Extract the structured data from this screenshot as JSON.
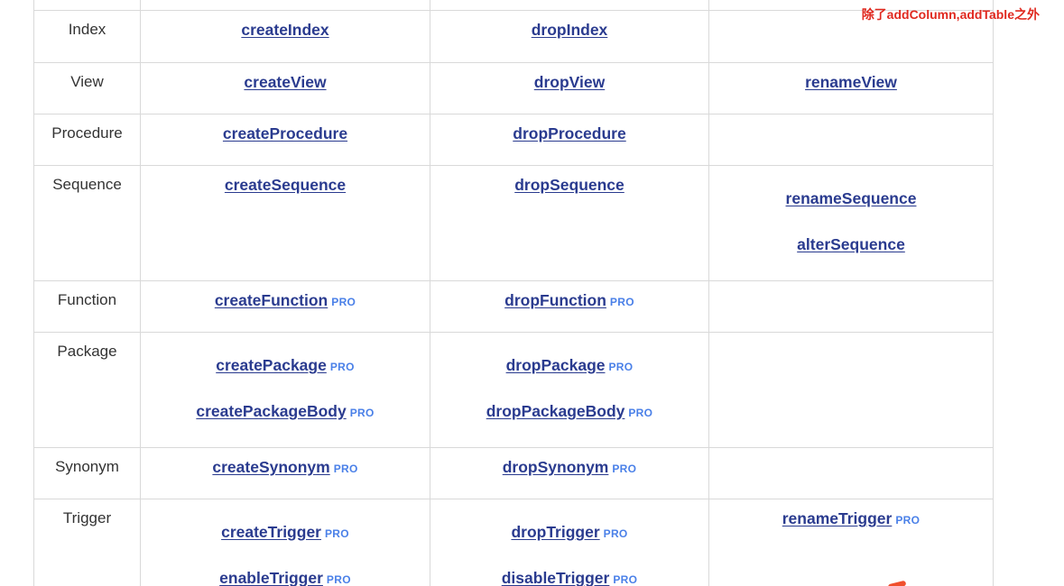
{
  "annotation": {
    "text": "除了addColumn,addTable之外",
    "color": "#e0291f"
  },
  "colors": {
    "link": "#2a3b8f",
    "pro_badge": "#4a80e8",
    "border": "#d9d9d9",
    "type_text": "#333333"
  },
  "pro_label": "PRO",
  "rows": [
    {
      "type": "Index",
      "create": [
        {
          "label": "createIndex",
          "pro": false
        }
      ],
      "drop": [
        {
          "label": "dropIndex",
          "pro": false
        }
      ],
      "other": []
    },
    {
      "type": "View",
      "create": [
        {
          "label": "createView",
          "pro": false
        }
      ],
      "drop": [
        {
          "label": "dropView",
          "pro": false
        }
      ],
      "other": [
        {
          "label": "renameView",
          "pro": false
        }
      ]
    },
    {
      "type": "Procedure",
      "create": [
        {
          "label": "createProcedure",
          "pro": false
        }
      ],
      "drop": [
        {
          "label": "dropProcedure",
          "pro": false
        }
      ],
      "other": []
    },
    {
      "type": "Sequence",
      "create": [
        {
          "label": "createSequence",
          "pro": false
        }
      ],
      "drop": [
        {
          "label": "dropSequence",
          "pro": false
        }
      ],
      "other": [
        {
          "label": "renameSequence",
          "pro": false
        },
        {
          "label": "alterSequence",
          "pro": false
        }
      ]
    },
    {
      "type": "Function",
      "create": [
        {
          "label": "createFunction",
          "pro": true
        }
      ],
      "drop": [
        {
          "label": "dropFunction",
          "pro": true
        }
      ],
      "other": []
    },
    {
      "type": "Package",
      "create": [
        {
          "label": "createPackage",
          "pro": true
        },
        {
          "label": "createPackageBody",
          "pro": true
        }
      ],
      "drop": [
        {
          "label": "dropPackage",
          "pro": true
        },
        {
          "label": "dropPackageBody",
          "pro": true
        }
      ],
      "other": []
    },
    {
      "type": "Synonym",
      "create": [
        {
          "label": "createSynonym",
          "pro": true
        }
      ],
      "drop": [
        {
          "label": "dropSynonym",
          "pro": true
        }
      ],
      "other": []
    },
    {
      "type": "Trigger",
      "create": [
        {
          "label": "createTrigger",
          "pro": true
        },
        {
          "label": "enableTrigger",
          "pro": true
        }
      ],
      "drop": [
        {
          "label": "dropTrigger",
          "pro": true
        },
        {
          "label": "disableTrigger",
          "pro": true
        }
      ],
      "other": [
        {
          "label": "renameTrigger",
          "pro": true
        }
      ]
    }
  ]
}
